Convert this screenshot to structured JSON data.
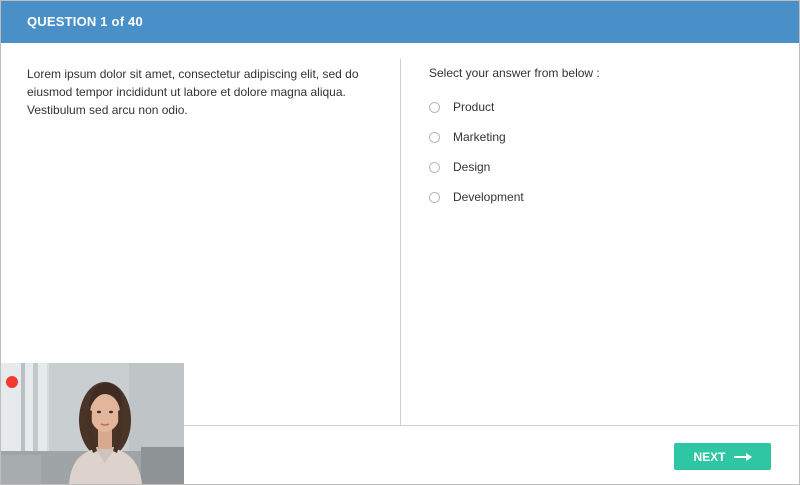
{
  "header": {
    "title": "QUESTION 1 of 40"
  },
  "question": {
    "text": "Lorem ipsum dolor sit amet, consectetur adipiscing elit, sed do eiusmod tempor incididunt ut labore et dolore magna aliqua. Vestibulum sed arcu non odio."
  },
  "answers": {
    "prompt": "Select your answer from below :",
    "options": [
      {
        "label": "Product",
        "selected": false
      },
      {
        "label": "Marketing",
        "selected": false
      },
      {
        "label": "Design",
        "selected": false
      },
      {
        "label": "Development",
        "selected": false
      }
    ]
  },
  "footer": {
    "next_label": "NEXT"
  },
  "webcam": {
    "recording": true
  },
  "colors": {
    "header": "#4a90c8",
    "next_button": "#2ec6a3",
    "rec_dot": "#f23a2f"
  }
}
